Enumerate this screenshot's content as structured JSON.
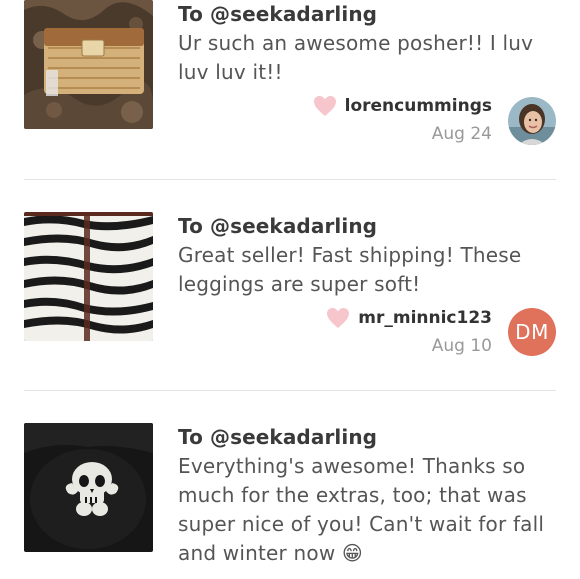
{
  "reviews": [
    {
      "to_prefix": "To ",
      "to_handle": "@seekadarling",
      "comment": "Ur such an awesome posher!! I luv luv luv it!!",
      "username": "lorencummings",
      "date": "Aug 24",
      "thumbnail_icon": "wicker-clutch-image",
      "avatar_type": "photo"
    },
    {
      "to_prefix": "To ",
      "to_handle": "@seekadarling",
      "comment": "Great seller! Fast shipping! These leggings are super soft!",
      "username": "mr_minnic123",
      "date": "Aug 10",
      "thumbnail_icon": "zebra-leggings-image",
      "avatar_type": "initials",
      "avatar_initials": "DM",
      "avatar_color": "#e0715a"
    },
    {
      "to_prefix": "To ",
      "to_handle": "@seekadarling",
      "comment": "Everything's awesome! Thanks so much for the extras, too; that was super nice of you! Can't wait for fall and winter now 😁",
      "thumbnail_icon": "skull-shirt-image"
    }
  ],
  "colors": {
    "heart": "#f7c6cc",
    "divider": "#e4e4e4",
    "text_primary": "#3a3a3a",
    "text_comment": "#555555",
    "text_date": "#999999"
  }
}
